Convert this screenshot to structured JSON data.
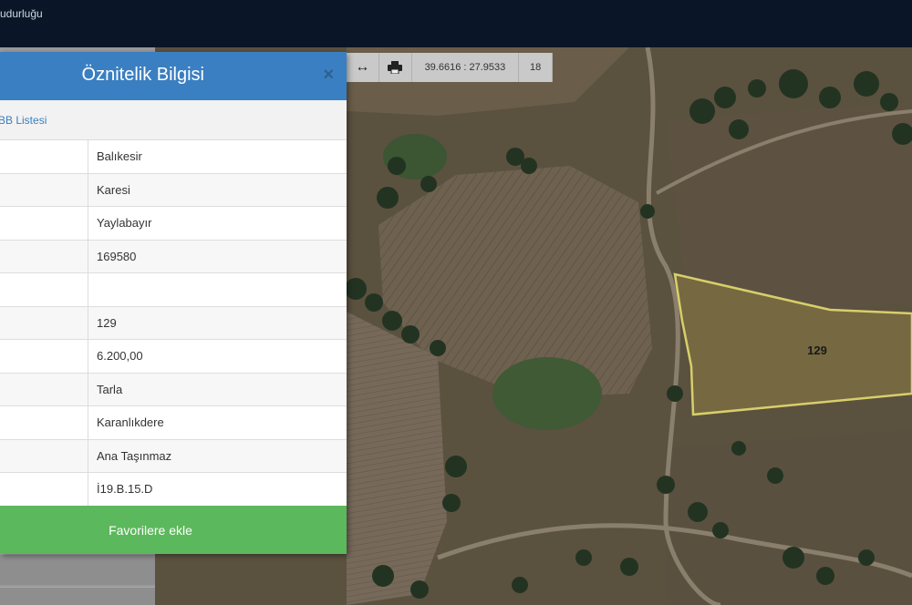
{
  "topbar": {
    "title": "udurluğu"
  },
  "toolbar": {
    "measure_icon": "arrows-horizontal-icon",
    "print_icon": "printer-icon",
    "coordinates": "39.6616 : 27.9533",
    "zoom_level": "18"
  },
  "panel": {
    "title": "Öznitelik Bilgisi",
    "close_label": "×",
    "list_link": "BB Listesi",
    "rows": [
      {
        "value": "Balıkesir"
      },
      {
        "value": "Karesi"
      },
      {
        "value": "Yaylabayır"
      },
      {
        "value": "169580"
      },
      {
        "value": ""
      },
      {
        "value": "129"
      },
      {
        "value": "6.200,00"
      },
      {
        "value": "Tarla"
      },
      {
        "value": "Karanlıkdere"
      },
      {
        "value": "Ana Taşınmaz"
      },
      {
        "value": "İ19.B.15.D"
      }
    ],
    "favorite_button": "Favorilere ekle"
  },
  "map": {
    "parcel_label": "129",
    "parcel_color": "#d8cf6a"
  }
}
